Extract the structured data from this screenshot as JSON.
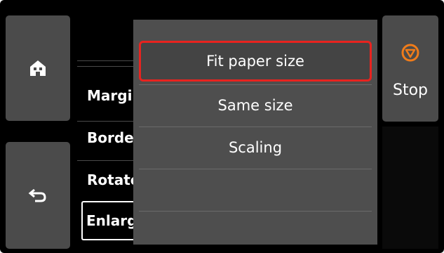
{
  "left_nav": {
    "home_icon": "home-icon",
    "back_icon": "back-arrow-icon"
  },
  "right_panel": {
    "stop_label": "Stop",
    "stop_icon": "stop-icon",
    "stop_color": "#f07c1a"
  },
  "background_list": {
    "items": [
      "Margi",
      "Borde",
      "Rotate",
      "Enlarg"
    ],
    "selected_index": 3
  },
  "popup": {
    "options": [
      "Fit paper size",
      "Same size",
      "Scaling",
      "",
      ""
    ],
    "highlighted_index": 0,
    "highlight_color": "#e8231f"
  }
}
